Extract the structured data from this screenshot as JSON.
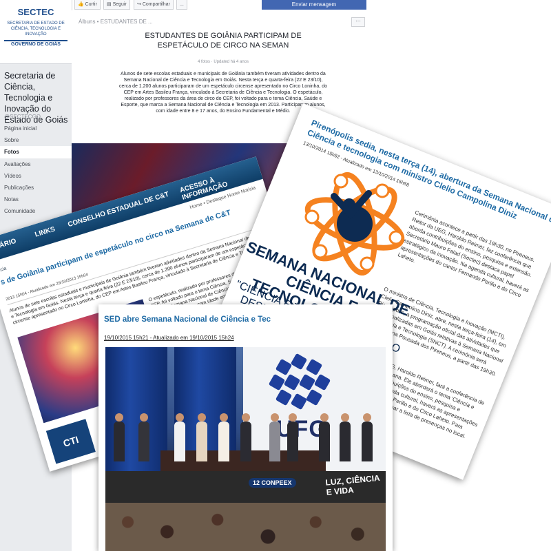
{
  "fb": {
    "logo": {
      "title": "SECTEC",
      "subtitle": "SECRETARIA DE ESTADO DE CIÊNCIA, TECNOLOGIA E INOVAÇÃO",
      "gov": "GOVERNO DE GOIÁS"
    },
    "page_name": "Secretaria de Ciência, Tecnologia e Inovação do Estado de Goiás",
    "handle": "@SECTECGO",
    "nav": [
      "Página inicial",
      "Sobre",
      "Fotos",
      "Avaliações",
      "Vídeos",
      "Publicações",
      "Notas",
      "Comunidade"
    ],
    "toolbar": {
      "like": "Curtir",
      "follow": "Seguir",
      "share": "Compartilhar",
      "more": "...",
      "send": "Enviar mensagem"
    },
    "breadcrumb": "Álbuns • ESTUDANTES DE ...",
    "album_title": "ESTUDANTES DE GOIÂNIA PARTICIPAM DE ESPETÁCULO DE CIRCO NA SEMAN",
    "album_meta": "4 fotos · Updated há 4 anos",
    "album_desc": "Alunos de sete escolas estaduais e municipais de Goiânia também tiveram atividades dentro da Semana Nacional de Ciência e Tecnologia em Goiás. Nesta terça e quarta-feira (22 E 23/10), cerca de 1.200 alunos participaram de um espetáculo circense apresentado no Circo Loninha, do CEP em Artes Basileu França, vinculado à Secretaria de Ciência e Tecnologia. O espetáculo, realizado por professores da área de circo do CEP, foi voltado para o tema Ciência, Saúde e Esporte, que marca a Semana Nacional de Ciência e Tecnologia em 2013. Participaram alunos, com idade entre 8 e 17 anos, do Ensino Fundamental e Médio."
  },
  "card_a": {
    "nav": [
      "RETÁRIO",
      "LINKS",
      "CONSELHO ESTADUAL DE C&T",
      "ACESSO À INFORMAÇÃO"
    ],
    "crumb": "Home • Destaque Home Notícia",
    "sub": "Notícia",
    "title": "s de Goiânia participam de espetáculo no circo na Semana de C&T",
    "date": "2013 15h04 - Atualizado em 29/10/2013 15h04",
    "body1": "Alunos de sete escolas estaduais e municipais de Goiânia também tiveram atividades dentro da Semana Nacional de Ciência e Tecnologia em Goiás. Nesta terça e quarta-feira (22 E 23/10), cerca de 1.200 alunos participaram de um espetáculo circense apresentado no Circo Loninha, do CEP em Artes Basileu França, vinculado à Secretaria de Ciência e Tecnologia.",
    "body2": "O espetáculo, realizado por professores da área de circo do CEP, foi voltado para o tema Ciência, Saúde e Esporte, que marca a Semana Nacional de Ciência e Tecnologia em 2013. Participaram alunos, com idade entre 8 e 17 anos, do Ensino Fundamental e Médio.",
    "logo": "CTI"
  },
  "card_b": {
    "title": "Pirenópolis sedia, nesta terça (14), abertura da Semana Nacional de Ciência e tecnologia com ministro Clelio Campolina Diniz",
    "date": "13/10/2014 15h52 - Atualizado em 13/10/2014 15h58",
    "p1": "Cerimônia acontece a partir das 19h30, no Pireneus. Reitor da UEG, Haroldo Reimer, faz conferência que aborda contribuições do ensino, pesquisa e extensão. Secretário Mauro Faiad (Sectec) destaca papel estratégico da inovação. Na agenda cultural, haverá as apresentações do cantor Fernando Perillo e do Circo Laheto.",
    "p2": "O ministro de Ciência, Tecnologia e Inovação (MCTI), Clelio Campolina Diniz, abre, nesta terça-feira (14), em Pirenópolis, a programação oficial das atividades que serão realizadas em Goiás relativas à Semana Nacional de Ciência e Tecnologia (SNCT). A cerimônia será realizada na Pousada dos Pireneus, a partir das 19h30.",
    "p3": "O reitor da UEG, Haroldo Reimer, fará a conferência de abertura da semana. Ele abordará o tema 'Ciência e tecnologia: contribuições do ensino, pesquisa e extensão'. Na agenda cultural, haverá as apresentações do cantor Fernando Perillo e do Circo Laheto. Para participar, basta assinar a lista de presenças no local."
  },
  "snct": {
    "name": "SEMANA NACIONAL DE CIÊNCIA E TECNOLOGIA 2014",
    "tagline": "\"CIÊNCIA E TECNOLOGIA PARA O DESENVOLVIMENTO SOCIAL\"",
    "colors": {
      "orange": "#f58220",
      "navy": "#0d2b52"
    }
  },
  "card_c": {
    "title": "SED abre Semana Nacional de Ciência e Tec",
    "date": "19/10/2015 15h21 - Atualizado em 19/10/2015 15h24",
    "banner": "UFG",
    "event": "12 CONPEEX",
    "theme": "LUZ, CIÊNCIA E VIDA"
  }
}
